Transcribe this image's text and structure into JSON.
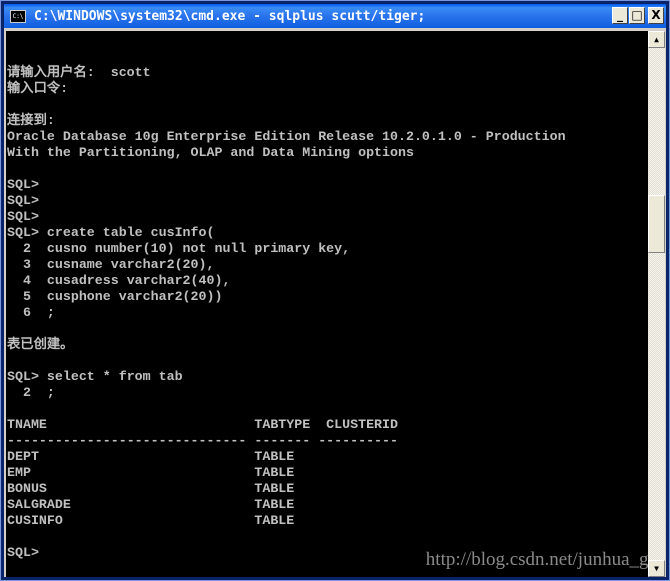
{
  "window": {
    "title": "C:\\WINDOWS\\system32\\cmd.exe - sqlplus scutt/tiger;",
    "icon": "cmd-icon",
    "icon_label": "C:\\",
    "minimize": "_",
    "maximize": "□",
    "close": "X"
  },
  "console": {
    "lines": [
      "",
      "",
      "请输入用户名:  scott",
      "输入口令:",
      "",
      "连接到:",
      "Oracle Database 10g Enterprise Edition Release 10.2.0.1.0 - Production",
      "With the Partitioning, OLAP and Data Mining options",
      "",
      "SQL>",
      "SQL>",
      "SQL>",
      "SQL> create table cusInfo(",
      "  2  cusno number(10) not null primary key,",
      "  3  cusname varchar2(20),",
      "  4  cusadress varchar2(40),",
      "  5  cusphone varchar2(20))",
      "  6  ;",
      "",
      "表已创建。",
      "",
      "SQL> select * from tab",
      "  2  ;",
      "",
      "TNAME                          TABTYPE  CLUSTERID",
      "------------------------------ ------- ----------",
      "DEPT                           TABLE",
      "EMP                            TABLE",
      "BONUS                          TABLE",
      "SALGRADE                       TABLE",
      "CUSINFO                        TABLE",
      "",
      "SQL>"
    ]
  },
  "watermark": "http://blog.csdn.net/junhua_gu",
  "scrollbar": {
    "up": "▲",
    "down": "▼"
  },
  "colors": {
    "titlebar": "#2a73ec",
    "console_bg": "#000000",
    "console_text": "#c0c0c0"
  }
}
